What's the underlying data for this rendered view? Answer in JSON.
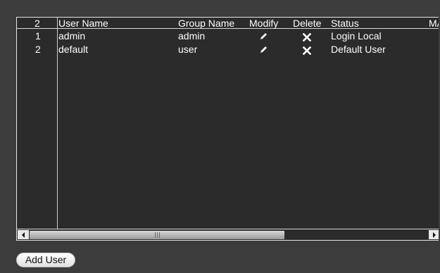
{
  "table": {
    "header": {
      "count": "2",
      "user_name": "User Name",
      "group_name": "Group Name",
      "modify": "Modify",
      "delete": "Delete",
      "status": "Status",
      "mac": "MA"
    },
    "rows": [
      {
        "index": "1",
        "user_name": "admin",
        "group_name": "admin",
        "status": "Login Local"
      },
      {
        "index": "2",
        "user_name": "default",
        "group_name": "user",
        "status": "Default User"
      }
    ]
  },
  "icons": {
    "modify": "pencil-icon",
    "delete": "x-icon",
    "scroll_left": "arrow-left-icon",
    "scroll_right": "arrow-right-icon"
  },
  "scrollbar": {
    "position_fraction": 0.0,
    "visible_fraction": 0.62
  },
  "buttons": {
    "add_user": "Add User"
  },
  "colors": {
    "background": "#3c3c3c",
    "table_bg": "#2b2b2b",
    "grid_line": "#cfcfcf",
    "text": "#ffffff"
  }
}
